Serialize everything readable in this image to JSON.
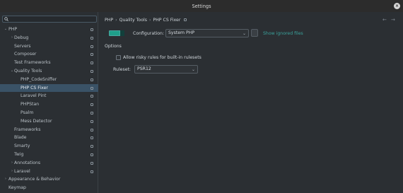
{
  "window": {
    "title": "Settings"
  },
  "search": {
    "value": ""
  },
  "tree": [
    {
      "label": "PHP",
      "indent": 0,
      "arrow": "down",
      "page": true
    },
    {
      "label": "Debug",
      "indent": 1,
      "arrow": "right",
      "page": true
    },
    {
      "label": "Servers",
      "indent": 1,
      "arrow": "",
      "page": true
    },
    {
      "label": "Composer",
      "indent": 1,
      "arrow": "",
      "page": true
    },
    {
      "label": "Test Frameworks",
      "indent": 1,
      "arrow": "",
      "page": true
    },
    {
      "label": "Quality Tools",
      "indent": 1,
      "arrow": "down",
      "page": true
    },
    {
      "label": "PHP_CodeSniffer",
      "indent": 2,
      "arrow": "",
      "page": true
    },
    {
      "label": "PHP CS Fixer",
      "indent": 2,
      "arrow": "",
      "page": true,
      "selected": true
    },
    {
      "label": "Laravel Pint",
      "indent": 2,
      "arrow": "",
      "page": true
    },
    {
      "label": "PHPStan",
      "indent": 2,
      "arrow": "",
      "page": true
    },
    {
      "label": "Psalm",
      "indent": 2,
      "arrow": "",
      "page": true
    },
    {
      "label": "Mess Detector",
      "indent": 2,
      "arrow": "",
      "page": true
    },
    {
      "label": "Frameworks",
      "indent": 1,
      "arrow": "",
      "page": true
    },
    {
      "label": "Blade",
      "indent": 1,
      "arrow": "",
      "page": true
    },
    {
      "label": "Smarty",
      "indent": 1,
      "arrow": "",
      "page": true
    },
    {
      "label": "Twig",
      "indent": 1,
      "arrow": "",
      "page": true
    },
    {
      "label": "Annotations",
      "indent": 1,
      "arrow": "right",
      "page": true
    },
    {
      "label": "Laravel",
      "indent": 1,
      "arrow": "right",
      "page": true
    },
    {
      "label": "Appearance & Behavior",
      "indent": 0,
      "arrow": "right",
      "page": false
    },
    {
      "label": "Keymap",
      "indent": 0,
      "arrow": "",
      "page": false
    }
  ],
  "breadcrumb": {
    "part1": "PHP",
    "part2": "Quality Tools",
    "part3": "PHP CS Fixer",
    "sep": "›"
  },
  "nav": {
    "back": "←",
    "forward": "→"
  },
  "configuration": {
    "label": "Configuration:",
    "value": "System PHP"
  },
  "show_ignored_files": "Show ignored files",
  "options": {
    "section_label": "Options",
    "risky_label": "Allow risky rules for built-in rulesets",
    "risky_checked": false,
    "ruleset_label": "Ruleset:",
    "ruleset_value": "PSR12"
  },
  "colors": {
    "accent": "#1f9f8a",
    "selection": "#3a5266",
    "link": "#3aa19b"
  }
}
